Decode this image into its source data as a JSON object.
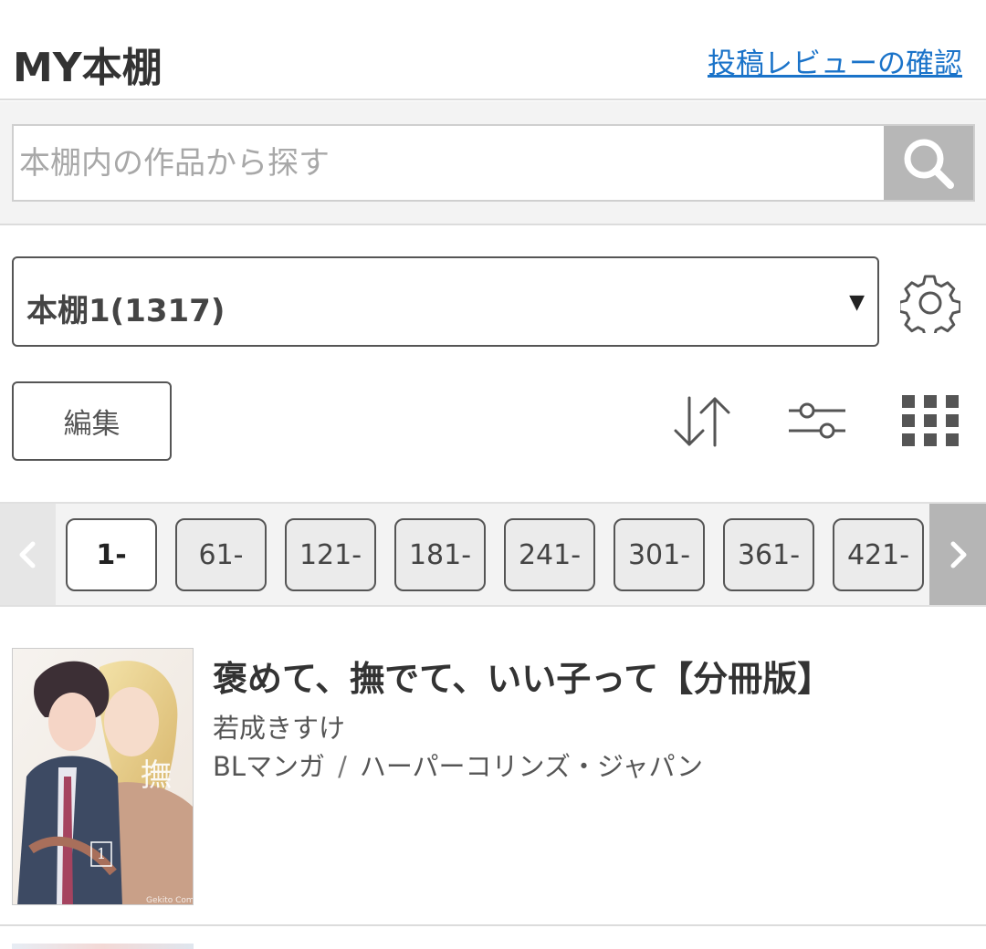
{
  "header": {
    "title": "MY本棚",
    "review_link": "投稿レビューの確認"
  },
  "search": {
    "placeholder": "本棚内の作品から探す",
    "value": ""
  },
  "shelf": {
    "selected": "本棚1(1317)",
    "caret": "▼"
  },
  "toolbar": {
    "edit_label": "編集"
  },
  "pagination": {
    "pages": [
      "1-",
      "61-",
      "121-",
      "181-",
      "241-",
      "301-",
      "361-",
      "421-"
    ],
    "active_index": 0
  },
  "books": [
    {
      "title": "褒めて、撫でて、いい子って【分冊版】",
      "author": "若成きすけ",
      "genre": "BLマンガ",
      "separator": "/",
      "publisher": "ハーパーコリンズ・ジャパン"
    }
  ],
  "colors": {
    "link": "#1a73c9",
    "search_button": "#b7b7b7",
    "band": "#f3f3f3"
  }
}
